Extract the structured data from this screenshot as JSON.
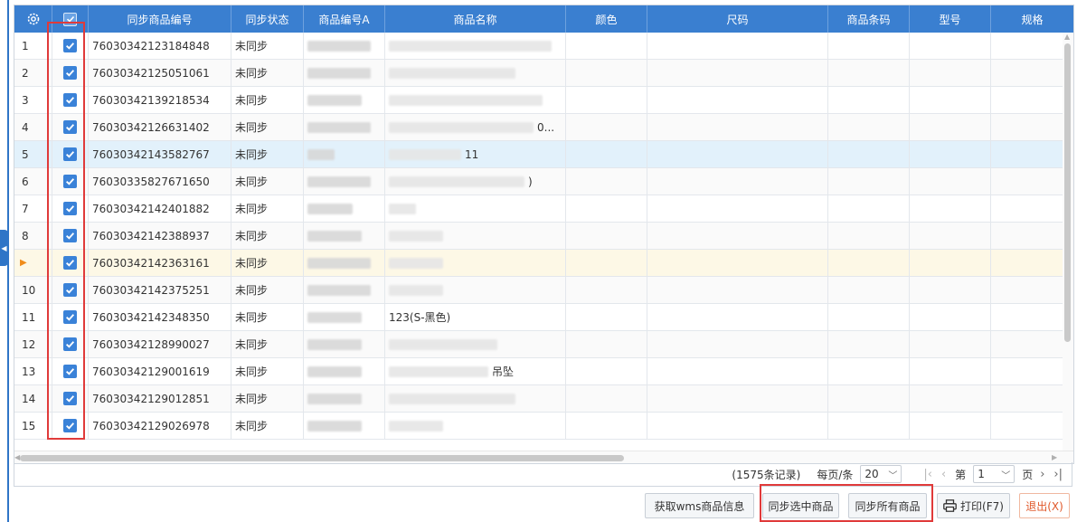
{
  "header": {
    "settings_icon": "gear-icon",
    "columns": [
      "同步商品编号",
      "同步状态",
      "商品编号A",
      "商品名称",
      "颜色",
      "尺码",
      "商品条码",
      "型号",
      "规格"
    ]
  },
  "rows": [
    {
      "num": "1",
      "code": "76030342123184848",
      "status": "未同步",
      "name_visible": ""
    },
    {
      "num": "2",
      "code": "76030342125051061",
      "status": "未同步",
      "name_visible": ""
    },
    {
      "num": "3",
      "code": "76030342139218534",
      "status": "未同步",
      "name_visible": ""
    },
    {
      "num": "4",
      "code": "76030342126631402",
      "status": "未同步",
      "name_visible": "0..."
    },
    {
      "num": "5",
      "code": "76030342143582767",
      "status": "未同步",
      "name_visible": "11"
    },
    {
      "num": "6",
      "code": "76030335827671650",
      "status": "未同步",
      "name_visible": ")"
    },
    {
      "num": "7",
      "code": "76030342142401882",
      "status": "未同步",
      "name_visible": ""
    },
    {
      "num": "8",
      "code": "76030342142388937",
      "status": "未同步",
      "name_visible": ""
    },
    {
      "num": "",
      "code": "76030342142363161",
      "status": "未同步",
      "name_visible": ""
    },
    {
      "num": "10",
      "code": "76030342142375251",
      "status": "未同步",
      "name_visible": ""
    },
    {
      "num": "11",
      "code": "76030342142348350",
      "status": "未同步",
      "name_visible": "123(S-黑色)"
    },
    {
      "num": "12",
      "code": "76030342128990027",
      "status": "未同步",
      "name_visible": ""
    },
    {
      "num": "13",
      "code": "76030342129001619",
      "status": "未同步",
      "name_visible": "吊坠"
    },
    {
      "num": "14",
      "code": "76030342129012851",
      "status": "未同步",
      "name_visible": ""
    },
    {
      "num": "15",
      "code": "76030342129026978",
      "status": "未同步",
      "name_visible": ""
    }
  ],
  "pager": {
    "total": "(1575条记录)",
    "per_page_label": "每页/条",
    "per_page_value": "20",
    "page_label_before": "第",
    "page_value": "1",
    "page_label_after": "页"
  },
  "toolbar": {
    "fetch_wms": "获取wms商品信息",
    "sync_selected": "同步选中商品",
    "sync_all": "同步所有商品",
    "print": "打印(F7)",
    "exit": "退出(X)"
  },
  "colors": {
    "header_bg": "#3a7fd0",
    "checkbox": "#3a82d8",
    "selected_row": "#e2f1fb",
    "current_row": "#fdf8e6",
    "highlight_border": "#e03a3a",
    "exit_text": "#e0582a"
  }
}
